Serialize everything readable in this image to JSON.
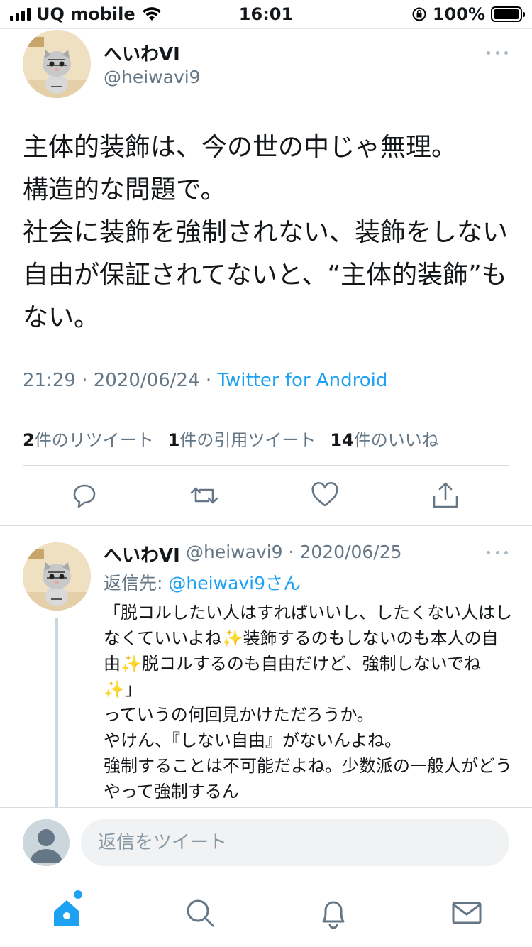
{
  "status_bar": {
    "carrier": "UQ mobile",
    "time": "16:01",
    "battery": "100%"
  },
  "tweet": {
    "author_name": "へいわVI",
    "author_handle": "@heiwavi9",
    "text": "主体的装飾は、今の世の中じゃ無理。\n構造的な問題で。\n社会に装飾を強制されない、装飾をしない自由が保証されてないと、“主体的装飾”もない。",
    "time": "21:29",
    "date": "2020/06/24",
    "source": "Twitter for Android",
    "retweets_count": "2",
    "retweets_label": "件のリツイート",
    "quotes_count": "1",
    "quotes_label": "件の引用ツイート",
    "likes_count": "14",
    "likes_label": "件のいいね"
  },
  "reply": {
    "author_name": "へいわVI",
    "author_handle": "@heiwavi9",
    "date": "2020/06/25",
    "replying_to_label": "返信先:",
    "replying_to_handle": "@heiwavi9さん",
    "text": "「脱コルしたい人はすればいいし、したくない人はしなくていいよね✨装飾するのもしないのも本人の自由✨脱コルするのも自由だけど、強制しないでね✨」\nっていうの何回見かけただろうか。\nやけん、『しない自由』がないんよね。\n強制することは不可能だよね。少数派の一般人がどうやって強制するん"
  },
  "compose": {
    "placeholder": "返信をツイート"
  },
  "icons": {
    "reply": "reply-icon",
    "retweet": "retweet-icon",
    "like": "heart-icon",
    "share": "share-icon",
    "home": "home-icon",
    "search": "search-icon",
    "notifications": "bell-icon",
    "messages": "mail-icon"
  },
  "colors": {
    "accent": "#1da1f2",
    "secondary_text": "#657786",
    "icon": "#657786"
  }
}
